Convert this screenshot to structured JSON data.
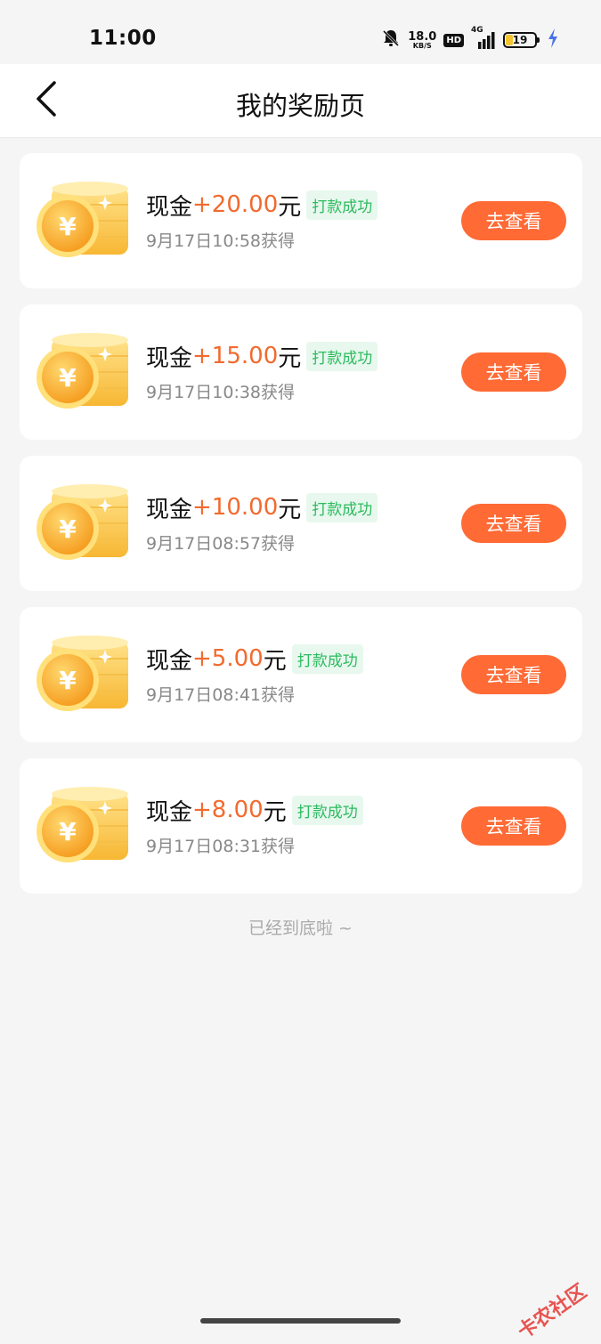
{
  "status_bar": {
    "time": "11:00",
    "net_speed_value": "18.0",
    "net_speed_unit": "KB/S",
    "hd_label": "HD",
    "signal_label": "4G",
    "battery_level": "19"
  },
  "header": {
    "title": "我的奖励页"
  },
  "rewards": [
    {
      "label": "现金",
      "amount": "+20.00",
      "unit": "元",
      "status": "打款成功",
      "time": "9月17日10:58获得",
      "button": "去查看"
    },
    {
      "label": "现金",
      "amount": "+15.00",
      "unit": "元",
      "status": "打款成功",
      "time": "9月17日10:38获得",
      "button": "去查看"
    },
    {
      "label": "现金",
      "amount": "+10.00",
      "unit": "元",
      "status": "打款成功",
      "time": "9月17日08:57获得",
      "button": "去查看"
    },
    {
      "label": "现金",
      "amount": "+5.00",
      "unit": "元",
      "status": "打款成功",
      "time": "9月17日08:41获得",
      "button": "去查看"
    },
    {
      "label": "现金",
      "amount": "+8.00",
      "unit": "元",
      "status": "打款成功",
      "time": "9月17日08:31获得",
      "button": "去查看"
    }
  ],
  "end_text": "已经到底啦 ~",
  "watermark": "卡农社区",
  "colors": {
    "accent": "#ff6a35",
    "amount": "#f26a2e",
    "success": "#2cbb5f",
    "success_bg": "#e8f8ee",
    "background": "#f5f5f5"
  },
  "icons": [
    "back-arrow-icon",
    "coin-stack-icon",
    "bell-muted-icon",
    "signal-icon",
    "battery-icon",
    "charging-icon"
  ]
}
